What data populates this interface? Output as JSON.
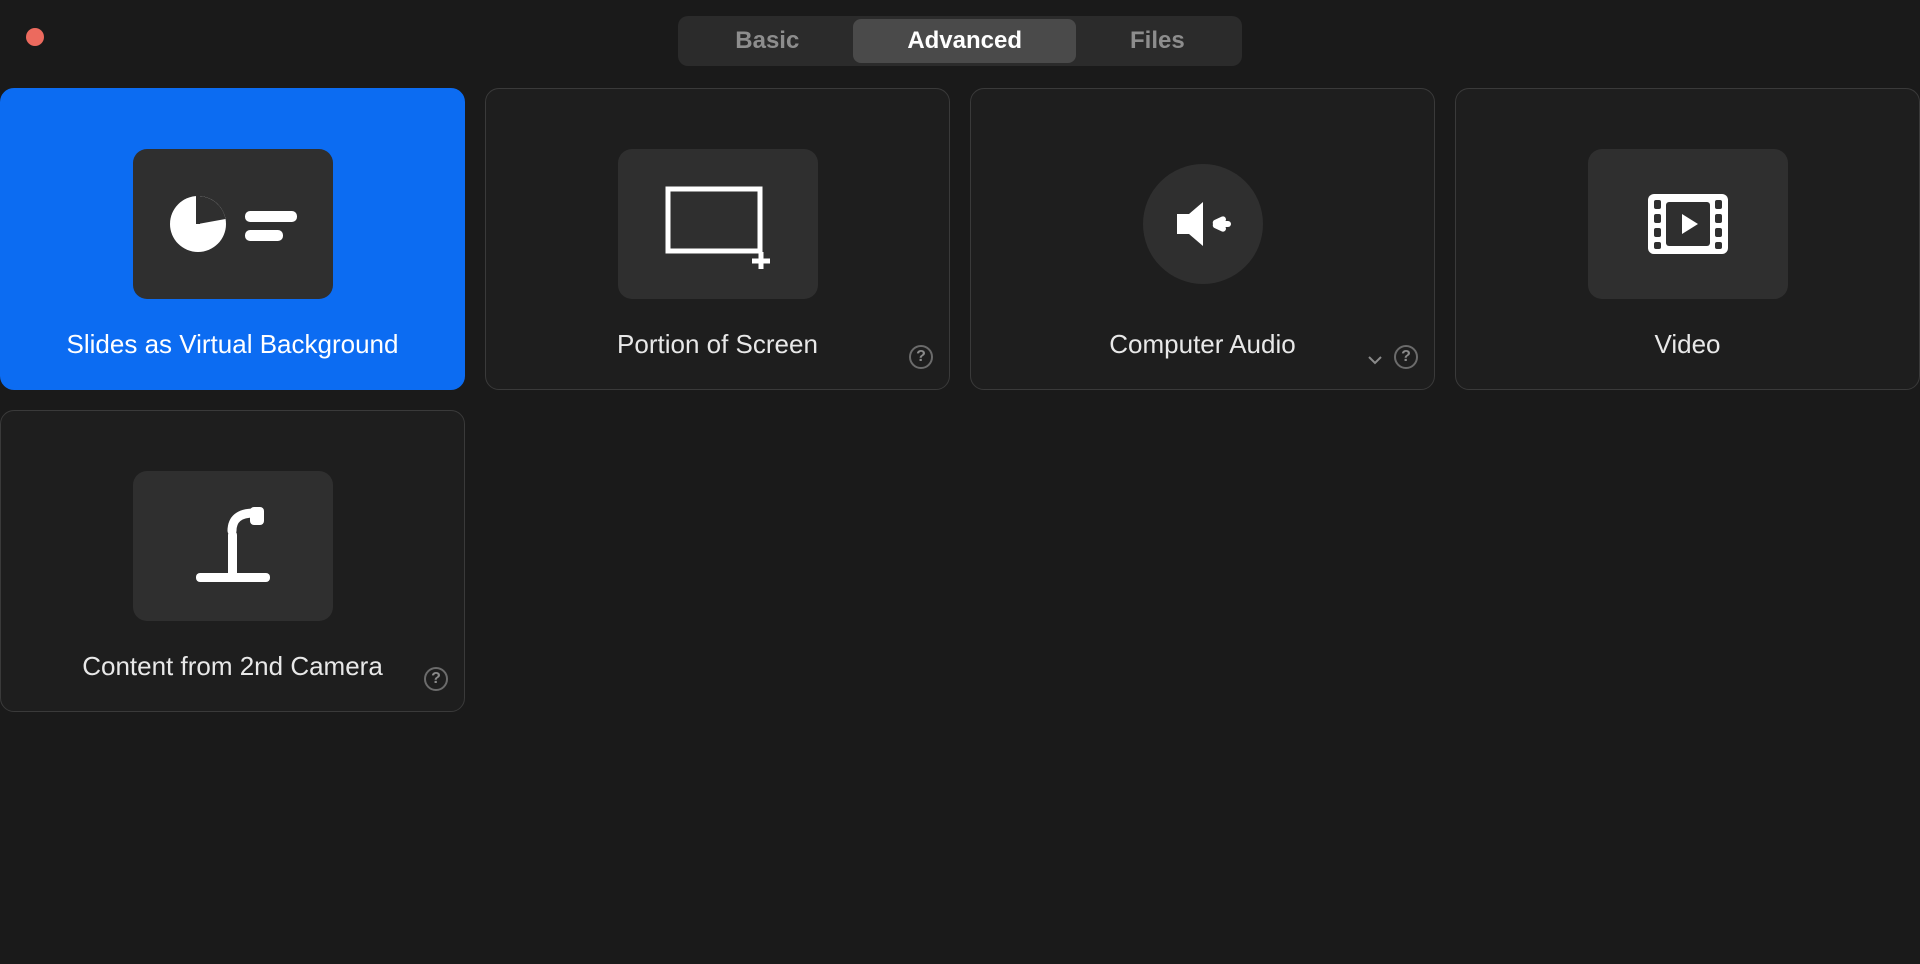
{
  "window": {
    "close_label": "Close"
  },
  "tabs": {
    "basic": "Basic",
    "advanced": "Advanced",
    "files": "Files",
    "active": "advanced"
  },
  "cards": {
    "slides_vb": {
      "label": "Slides as Virtual Background",
      "selected": true
    },
    "portion_screen": {
      "label": "Portion of Screen",
      "has_help": true
    },
    "computer_audio": {
      "label": "Computer Audio",
      "has_help": true,
      "has_dropdown": true
    },
    "video": {
      "label": "Video"
    },
    "second_camera": {
      "label": "Content from 2nd Camera",
      "has_help": true
    }
  },
  "icons": {
    "help_glyph": "?"
  }
}
